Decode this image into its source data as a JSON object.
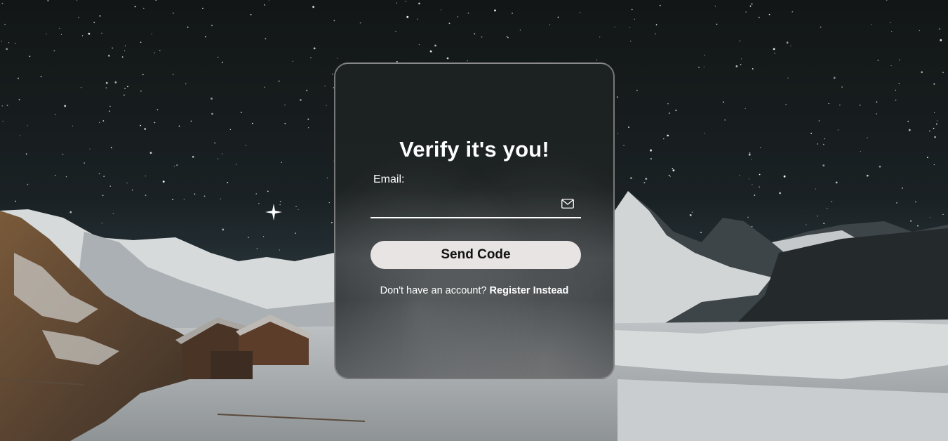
{
  "background": {
    "description_icon": "night-sky-mountain-scene"
  },
  "card": {
    "title": "Verify it's you!",
    "email_label": "Email:",
    "email_value": "",
    "email_icon": "mail-icon",
    "send_button_label": "Send Code",
    "register_prompt": "Don't have an account?",
    "register_link_label": "Register Instead"
  },
  "colors": {
    "button_bg": "#e8e4e3",
    "text": "#ffffff"
  }
}
